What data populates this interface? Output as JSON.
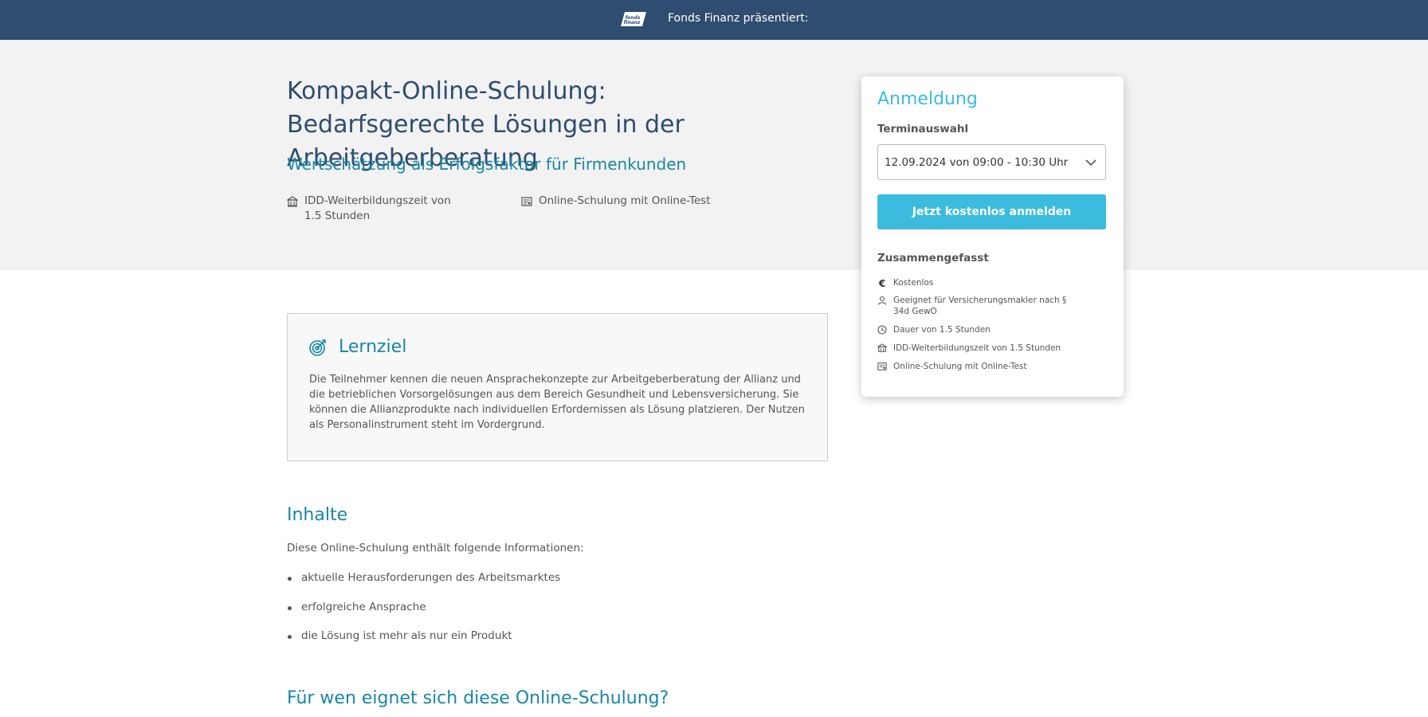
{
  "header": {
    "presents": "Fonds Finanz präsentiert:",
    "brand_color": "#2e4d70"
  },
  "course": {
    "title": "Kompakt-Online-Schulung: Bedarfsgerechte Lösungen in der Arbeitgeberberatung",
    "subtitle": "Wertschätzung als Erfolgsfaktor für Firmenkunden",
    "features": [
      {
        "icon": "building-icon",
        "text": "IDD-Weiterbildungszeit von 1.5 Stunden"
      },
      {
        "icon": "certificate-icon",
        "text": "Online-Schulung mit Online-Test"
      }
    ]
  },
  "registration": {
    "heading": "Anmeldung",
    "date_label": "Terminauswahl",
    "selected_date": "12.09.2024 von 09:00 - 10:30 Uhr",
    "cta_label": "Jetzt kostenlos anmelden",
    "accent_color": "#3bbcde",
    "summary_heading": "Zusammengefasst",
    "summary_items": [
      {
        "icon": "euro-icon",
        "text": "Kostenlos"
      },
      {
        "icon": "person-icon",
        "text": "Geeignet für Versicherungsmakler nach § 34d GewO"
      },
      {
        "icon": "clock-icon",
        "text": "Dauer von 1.5 Stunden"
      },
      {
        "icon": "building-icon",
        "text": "IDD-Weiterbildungszeit von 1.5 Stunden"
      },
      {
        "icon": "certificate-icon",
        "text": "Online-Schulung mit Online-Test"
      }
    ]
  },
  "lernziel": {
    "heading": "Lernziel",
    "text": "Die Teilnehmer kennen die neuen Ansprachekonzepte zur Arbeitgeberberatung der Allianz und die betrieblichen Vorsorgelösungen aus dem Bereich Gesundheit und Lebensversicherung. Sie können die Allianzprodukte nach individuellen Erfordernissen als Lösung platzieren. Der Nutzen als Personalinstrument steht im Vordergrund."
  },
  "inhalte": {
    "heading": "Inhalte",
    "intro": "Diese Online-Schulung enthält folgende Informationen:",
    "items": [
      "aktuelle Herausforderungen des Arbeitsmarktes",
      "erfolgreiche Ansprache",
      "die Lösung ist mehr als nur ein Produkt"
    ]
  },
  "audience": {
    "heading": "Für wen eignet sich diese Online-Schulung?"
  }
}
